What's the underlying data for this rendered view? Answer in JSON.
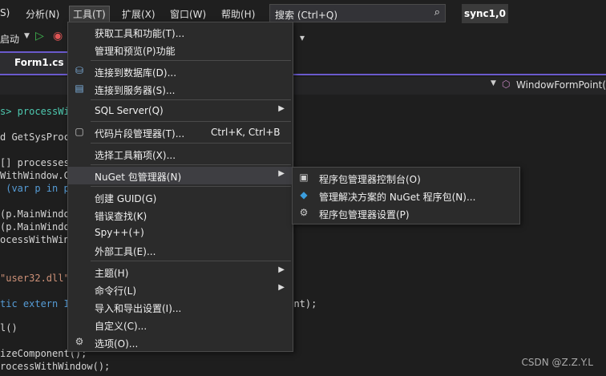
{
  "menubar": {
    "items": [
      "S)",
      "分析(N)",
      "工具(T)",
      "扩展(X)",
      "窗口(W)",
      "帮助(H)"
    ],
    "search_placeholder": "搜索 (Ctrl+Q)",
    "solution_name": "sync1,0"
  },
  "toolbar": {
    "start_label": "启动",
    "dropdown_glyph": "▾"
  },
  "tabs": {
    "active": "Form1.cs"
  },
  "navbar": {
    "member": "WindowFormPoint("
  },
  "code": [
    "s> processWit",
    "d GetSysProc",
    "[] processes",
    "WithWindow.C",
    " (var p in p",
    "(p.MainWindo",
    "(p.MainWindo",
    "ocessWithWind",
    "\"user32.dll\"",
    "tic extern I",
    "l()",
    "izeComponent();",
    "rocessWithWindow();",
    "oint);"
  ],
  "tools_menu": {
    "items": [
      {
        "label": "获取工具和功能(T)...",
        "icon": ""
      },
      {
        "label": "管理和预览(P)功能",
        "icon": ""
      },
      {
        "label": "连接到数据库(D)...",
        "icon": "database-connect-icon"
      },
      {
        "label": "连接到服务器(S)...",
        "icon": "server-connect-icon"
      },
      {
        "label": "SQL Server(Q)",
        "icon": ""
      },
      {
        "label": "代码片段管理器(T)...",
        "icon": "snippet-icon",
        "shortcut": "Ctrl+K, Ctrl+B"
      },
      {
        "label": "选择工具箱项(X)...",
        "icon": ""
      },
      {
        "label": "NuGet 包管理器(N)",
        "icon": ""
      },
      {
        "label": "创建 GUID(G)",
        "icon": ""
      },
      {
        "label": "错误查找(K)",
        "icon": ""
      },
      {
        "label": "Spy++(+)",
        "icon": ""
      },
      {
        "label": "外部工具(E)...",
        "icon": ""
      },
      {
        "label": "主题(H)",
        "icon": ""
      },
      {
        "label": "命令行(L)",
        "icon": ""
      },
      {
        "label": "导入和导出设置(I)...",
        "icon": ""
      },
      {
        "label": "自定义(C)...",
        "icon": ""
      },
      {
        "label": "选项(O)...",
        "icon": "gear-icon"
      }
    ]
  },
  "nuget_submenu": {
    "items": [
      {
        "label": "程序包管理器控制台(O)",
        "icon": "console-icon"
      },
      {
        "label": "管理解决方案的 NuGet 程序包(N)...",
        "icon": "nuget-icon"
      },
      {
        "label": "程序包管理器设置(P)",
        "icon": "gear-icon"
      }
    ]
  },
  "watermark": "CSDN @Z.Z.Y.L",
  "colors": {
    "accent": "#6a5acd",
    "menu_bg": "#2b2b2b",
    "highlight": "#3e3e42"
  }
}
